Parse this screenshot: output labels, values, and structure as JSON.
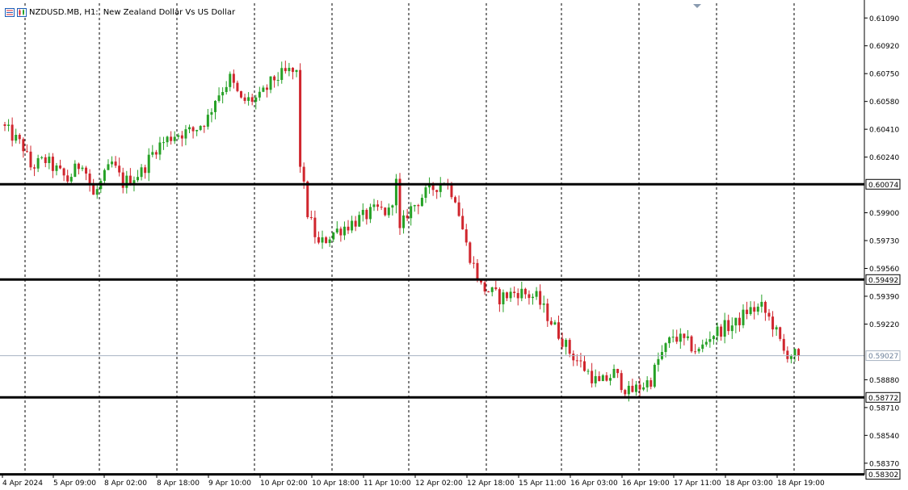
{
  "header": {
    "symbol": "NZDUSD.MB, H1:",
    "description": "New Zealand Dollar Vs US Dollar"
  },
  "colors": {
    "bull": "#26a126",
    "bear": "#d0262e",
    "grid": "#000000",
    "level": "#000000",
    "current_price_line": "#a7b3c2"
  },
  "icons": [
    "chart-list-icon",
    "chart-properties-icon"
  ],
  "chart_data": {
    "type": "candlestick",
    "symbol": "NZDUSD.MB",
    "timeframe": "H1",
    "ylim": [
      0.583,
      0.6118
    ],
    "y_ticks": [
      "0.61090",
      "0.60920",
      "0.60750",
      "0.60580",
      "0.60410",
      "0.60240",
      "0.59900",
      "0.59730",
      "0.59560",
      "0.59390",
      "0.59220",
      "0.58880",
      "0.58710",
      "0.58540",
      "0.58370"
    ],
    "x_ticks": [
      "4 Apr 2024",
      "5 Apr 09:00",
      "8 Apr 02:00",
      "8 Apr 18:00",
      "9 Apr 10:00",
      "10 Apr 02:00",
      "10 Apr 18:00",
      "11 Apr 10:00",
      "12 Apr 02:00",
      "12 Apr 18:00",
      "15 Apr 11:00",
      "16 Apr 03:00",
      "16 Apr 19:00",
      "17 Apr 11:00",
      "18 Apr 03:00",
      "18 Apr 19:00"
    ],
    "grid": "vertical dashed",
    "horizontal_levels": [
      "0.60074",
      "0.59492",
      "0.58772",
      "0.58302"
    ],
    "current_price": "0.59027",
    "trend": [
      [
        0,
        0.6044
      ],
      [
        6,
        0.603
      ],
      [
        8,
        0.6018
      ],
      [
        12,
        0.6022
      ],
      [
        18,
        0.601
      ],
      [
        22,
        0.6022
      ],
      [
        25,
        0.6
      ],
      [
        30,
        0.602
      ],
      [
        33,
        0.6008
      ],
      [
        38,
        0.6015
      ],
      [
        42,
        0.603
      ],
      [
        47,
        0.6038
      ],
      [
        52,
        0.604
      ],
      [
        56,
        0.6048
      ],
      [
        58,
        0.606
      ],
      [
        62,
        0.6072
      ],
      [
        65,
        0.6058
      ],
      [
        70,
        0.606
      ],
      [
        74,
        0.6072
      ],
      [
        78,
        0.6076
      ],
      [
        80,
        0.6075
      ],
      [
        81,
        0.602
      ],
      [
        83,
        0.599
      ],
      [
        86,
        0.597
      ],
      [
        90,
        0.5978
      ],
      [
        96,
        0.5985
      ],
      [
        102,
        0.5992
      ],
      [
        105,
        0.599
      ],
      [
        107,
        0.6008
      ],
      [
        108,
        0.5978
      ],
      [
        110,
        0.599
      ],
      [
        114,
        0.6
      ],
      [
        117,
        0.6005
      ],
      [
        120,
        0.601
      ],
      [
        123,
        0.6
      ],
      [
        126,
        0.597
      ],
      [
        130,
        0.5945
      ],
      [
        135,
        0.5938
      ],
      [
        140,
        0.5942
      ],
      [
        145,
        0.5938
      ],
      [
        150,
        0.592
      ],
      [
        154,
        0.5905
      ],
      [
        158,
        0.5895
      ],
      [
        162,
        0.5885
      ],
      [
        166,
        0.5892
      ],
      [
        170,
        0.588
      ],
      [
        174,
        0.5885
      ],
      [
        176,
        0.5888
      ],
      [
        178,
        0.59
      ],
      [
        182,
        0.5915
      ],
      [
        186,
        0.591
      ],
      [
        189,
        0.5905
      ],
      [
        192,
        0.5915
      ],
      [
        196,
        0.592
      ],
      [
        199,
        0.5922
      ],
      [
        202,
        0.593
      ],
      [
        206,
        0.5932
      ],
      [
        209,
        0.5922
      ],
      [
        212,
        0.5905
      ],
      [
        215,
        0.5903
      ]
    ]
  }
}
